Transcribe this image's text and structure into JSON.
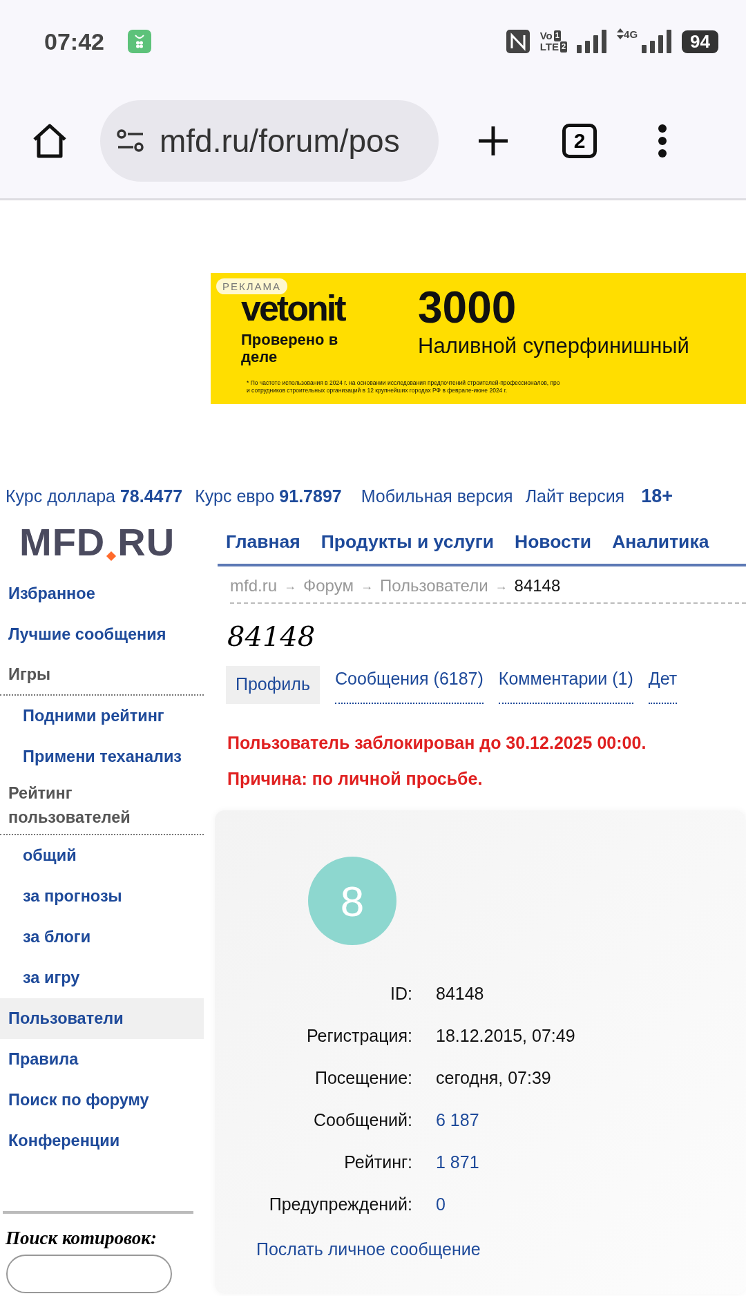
{
  "status_bar": {
    "time": "07:42",
    "volte": "Vo",
    "lte": "LTE",
    "sims": [
      "1",
      "2"
    ],
    "data_type": "4G",
    "battery": "94"
  },
  "browser": {
    "url": "mfd.ru/forum/pos",
    "tab_count": "2"
  },
  "ad": {
    "label": "РЕКЛАМА",
    "brand": "vetonit",
    "tagline": "Проверено в деле",
    "number": "3000",
    "product": "Наливной суперфинишный",
    "disclaimer": [
      "* По частоте использования в 2024 г. на основании исследования предпочтений строителей-профессионалов, про",
      "и сотрудников строительных организаций в 12 крупнейших городах РФ в феврале-июне 2024 г."
    ]
  },
  "top_links": {
    "rates": [
      {
        "label": "Курс доллара",
        "value": "78.4477"
      },
      {
        "label": "Курс евро",
        "value": "91.7897"
      }
    ],
    "links": [
      "Мобильная версия",
      "Лайт версия"
    ],
    "age": "18+"
  },
  "logo": {
    "left": "MFD",
    "right": "RU"
  },
  "nav": [
    "Главная",
    "Продукты и услуги",
    "Новости",
    "Аналитика"
  ],
  "sidebar": {
    "items": [
      {
        "kind": "link",
        "label": "Избранное",
        "selected": false
      },
      {
        "kind": "link",
        "label": "Лучшие сообщения",
        "selected": false
      },
      {
        "kind": "header",
        "label": "Игры",
        "selected": false
      },
      {
        "kind": "sublink",
        "label": "Подними рейтинг",
        "selected": false
      },
      {
        "kind": "sublink",
        "label": "Примени теханализ",
        "selected": false
      },
      {
        "kind": "header",
        "label": "Рейтинг пользователей",
        "selected": false
      },
      {
        "kind": "sublink",
        "label": "общий",
        "selected": false
      },
      {
        "kind": "sublink",
        "label": "за прогнозы",
        "selected": false
      },
      {
        "kind": "sublink",
        "label": "за блоги",
        "selected": false
      },
      {
        "kind": "sublink",
        "label": "за игру",
        "selected": false
      },
      {
        "kind": "link",
        "label": "Пользователи",
        "selected": true
      },
      {
        "kind": "link",
        "label": "Правила",
        "selected": false
      },
      {
        "kind": "link",
        "label": "Поиск по форуму",
        "selected": false
      },
      {
        "kind": "link",
        "label": "Конференции",
        "selected": false
      }
    ],
    "quote_search": {
      "title": "Поиск котировок:"
    }
  },
  "breadcrumbs": [
    {
      "label": "mfd.ru",
      "kind": "link"
    },
    {
      "label": "Форум",
      "kind": "link"
    },
    {
      "label": "Пользователи",
      "kind": "link"
    },
    {
      "label": "84148",
      "kind": "current"
    }
  ],
  "breadcrumb_separator": "→",
  "title": "84148",
  "tabs": [
    {
      "label": "Профиль",
      "selected": true
    },
    {
      "label": "Сообщения (6187)",
      "selected": false
    },
    {
      "label": "Комментарии (1)",
      "selected": false
    },
    {
      "label": "Дет",
      "selected": false
    }
  ],
  "notices": [
    "Пользователь заблокирован до 30.12.2025 00:00.",
    "Причина: по личной просьбе."
  ],
  "profile": {
    "avatar": "8",
    "rows": [
      {
        "label": "ID:",
        "value": "84148",
        "kind": "text"
      },
      {
        "label": "Регистрация:",
        "value": "18.12.2015, 07:49",
        "kind": "text"
      },
      {
        "label": "Посещение:",
        "value": "сегодня, 07:39",
        "kind": "text"
      },
      {
        "label": "Сообщений:",
        "value": "6 187",
        "kind": "link"
      },
      {
        "label": "Рейтинг:",
        "value": "1 871",
        "kind": "link"
      },
      {
        "label": "Предупреждений:",
        "value": "0",
        "kind": "link"
      }
    ],
    "message_link": "Послать личное сообщение"
  }
}
